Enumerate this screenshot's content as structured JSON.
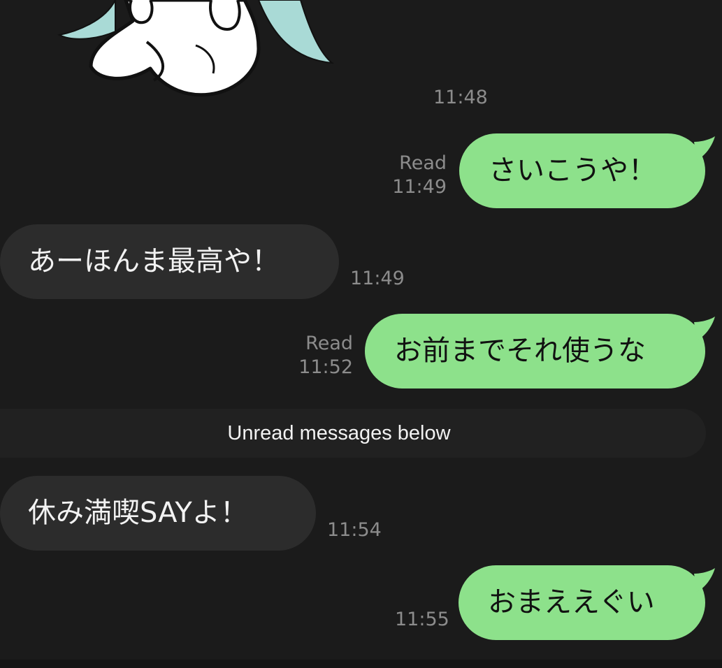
{
  "colors": {
    "background": "#1b1b1b",
    "outgoing_bubble": "#8de18b",
    "incoming_bubble": "#2c2c2c",
    "meta_text": "#8c8c8c"
  },
  "sticker": {
    "time": "11:48"
  },
  "messages": [
    {
      "direction": "out",
      "text": "さいこうや！",
      "read_label": "Read",
      "time": "11:49"
    },
    {
      "direction": "in",
      "text": "あーほんま最高や！",
      "time": "11:49"
    },
    {
      "direction": "out",
      "text": "お前までそれ使うな",
      "read_label": "Read",
      "time": "11:52"
    },
    {
      "direction": "in",
      "text": "休み満喫SAYよ！",
      "time": "11:54"
    },
    {
      "direction": "out",
      "text": "おまええぐい",
      "time": "11:55"
    }
  ],
  "unread_divider": {
    "label": "Unread messages below"
  }
}
